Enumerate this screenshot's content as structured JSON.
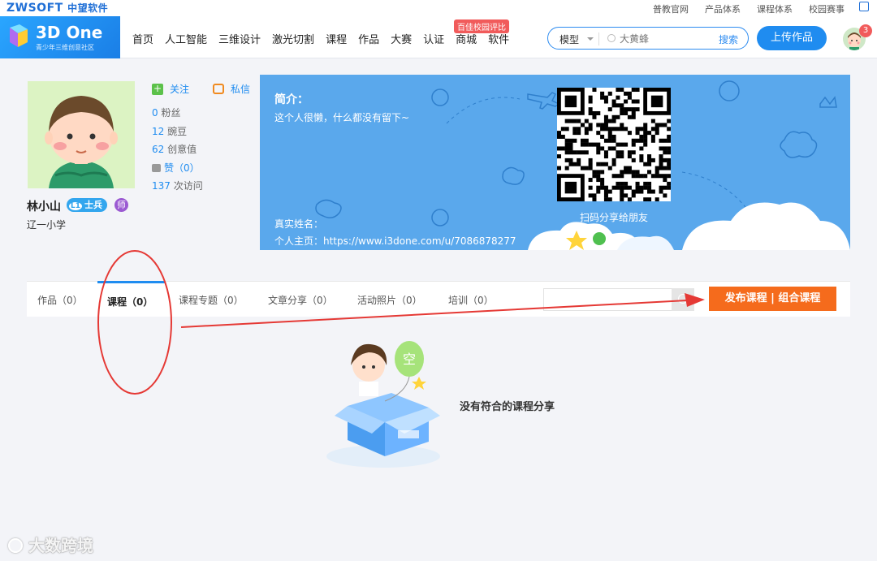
{
  "topbar": {
    "logo": "ZWSOFT",
    "logo_cn": "中望软件",
    "links": [
      "普教官网",
      "产品体系",
      "课程体系",
      "校园赛事"
    ]
  },
  "header": {
    "brand_title": "3D One",
    "brand_sub": "青少年三维创意社区",
    "nav": [
      "首页",
      "人工智能",
      "三维设计",
      "激光切割",
      "课程",
      "作品",
      "大赛",
      "认证",
      "商城",
      "软件"
    ],
    "cert_badge": "百佳校园评比",
    "search": {
      "type": "模型",
      "placeholder": "大黄蜂",
      "button": "搜索"
    },
    "upload_label": "上传作品",
    "notification_count": "3"
  },
  "profile": {
    "follow_label": "关注",
    "message_label": "私信",
    "stats": [
      {
        "num": "0",
        "label": "粉丝"
      },
      {
        "num": "12",
        "label": "豌豆"
      },
      {
        "num": "62",
        "label": "创意值"
      }
    ],
    "likes": "赞（0）",
    "visits_num": "137",
    "visits_label": "次访问",
    "name": "林小山",
    "level_code": "L1",
    "level_label": "士兵",
    "teacher_badge": "师",
    "school": "辽一小学"
  },
  "banner": {
    "intro_title": "简介：",
    "intro_text": "这个人很懒，什么都没有留下~",
    "realname_label": "真实姓名：",
    "homepage_label": "个人主页：https://www.i3done.com/u/7086878277",
    "qr_caption": "扫码分享给朋友"
  },
  "tabs": {
    "items": [
      "作品（0）",
      "课程（0）",
      "课程专题（0）",
      "文章分享（0）",
      "活动照片（0）",
      "培训（0）"
    ],
    "active_index": 1,
    "publish_label": "发布课程 | 组合课程"
  },
  "empty": {
    "balloon_char": "空",
    "message": "没有符合的课程分享"
  },
  "watermark": {
    "text": "大数跨境"
  },
  "colors": {
    "brand_blue": "#1f8cf0",
    "banner_blue": "#5aa8ec",
    "publish_orange": "#f56b1c",
    "annotation_red": "#e53935"
  }
}
